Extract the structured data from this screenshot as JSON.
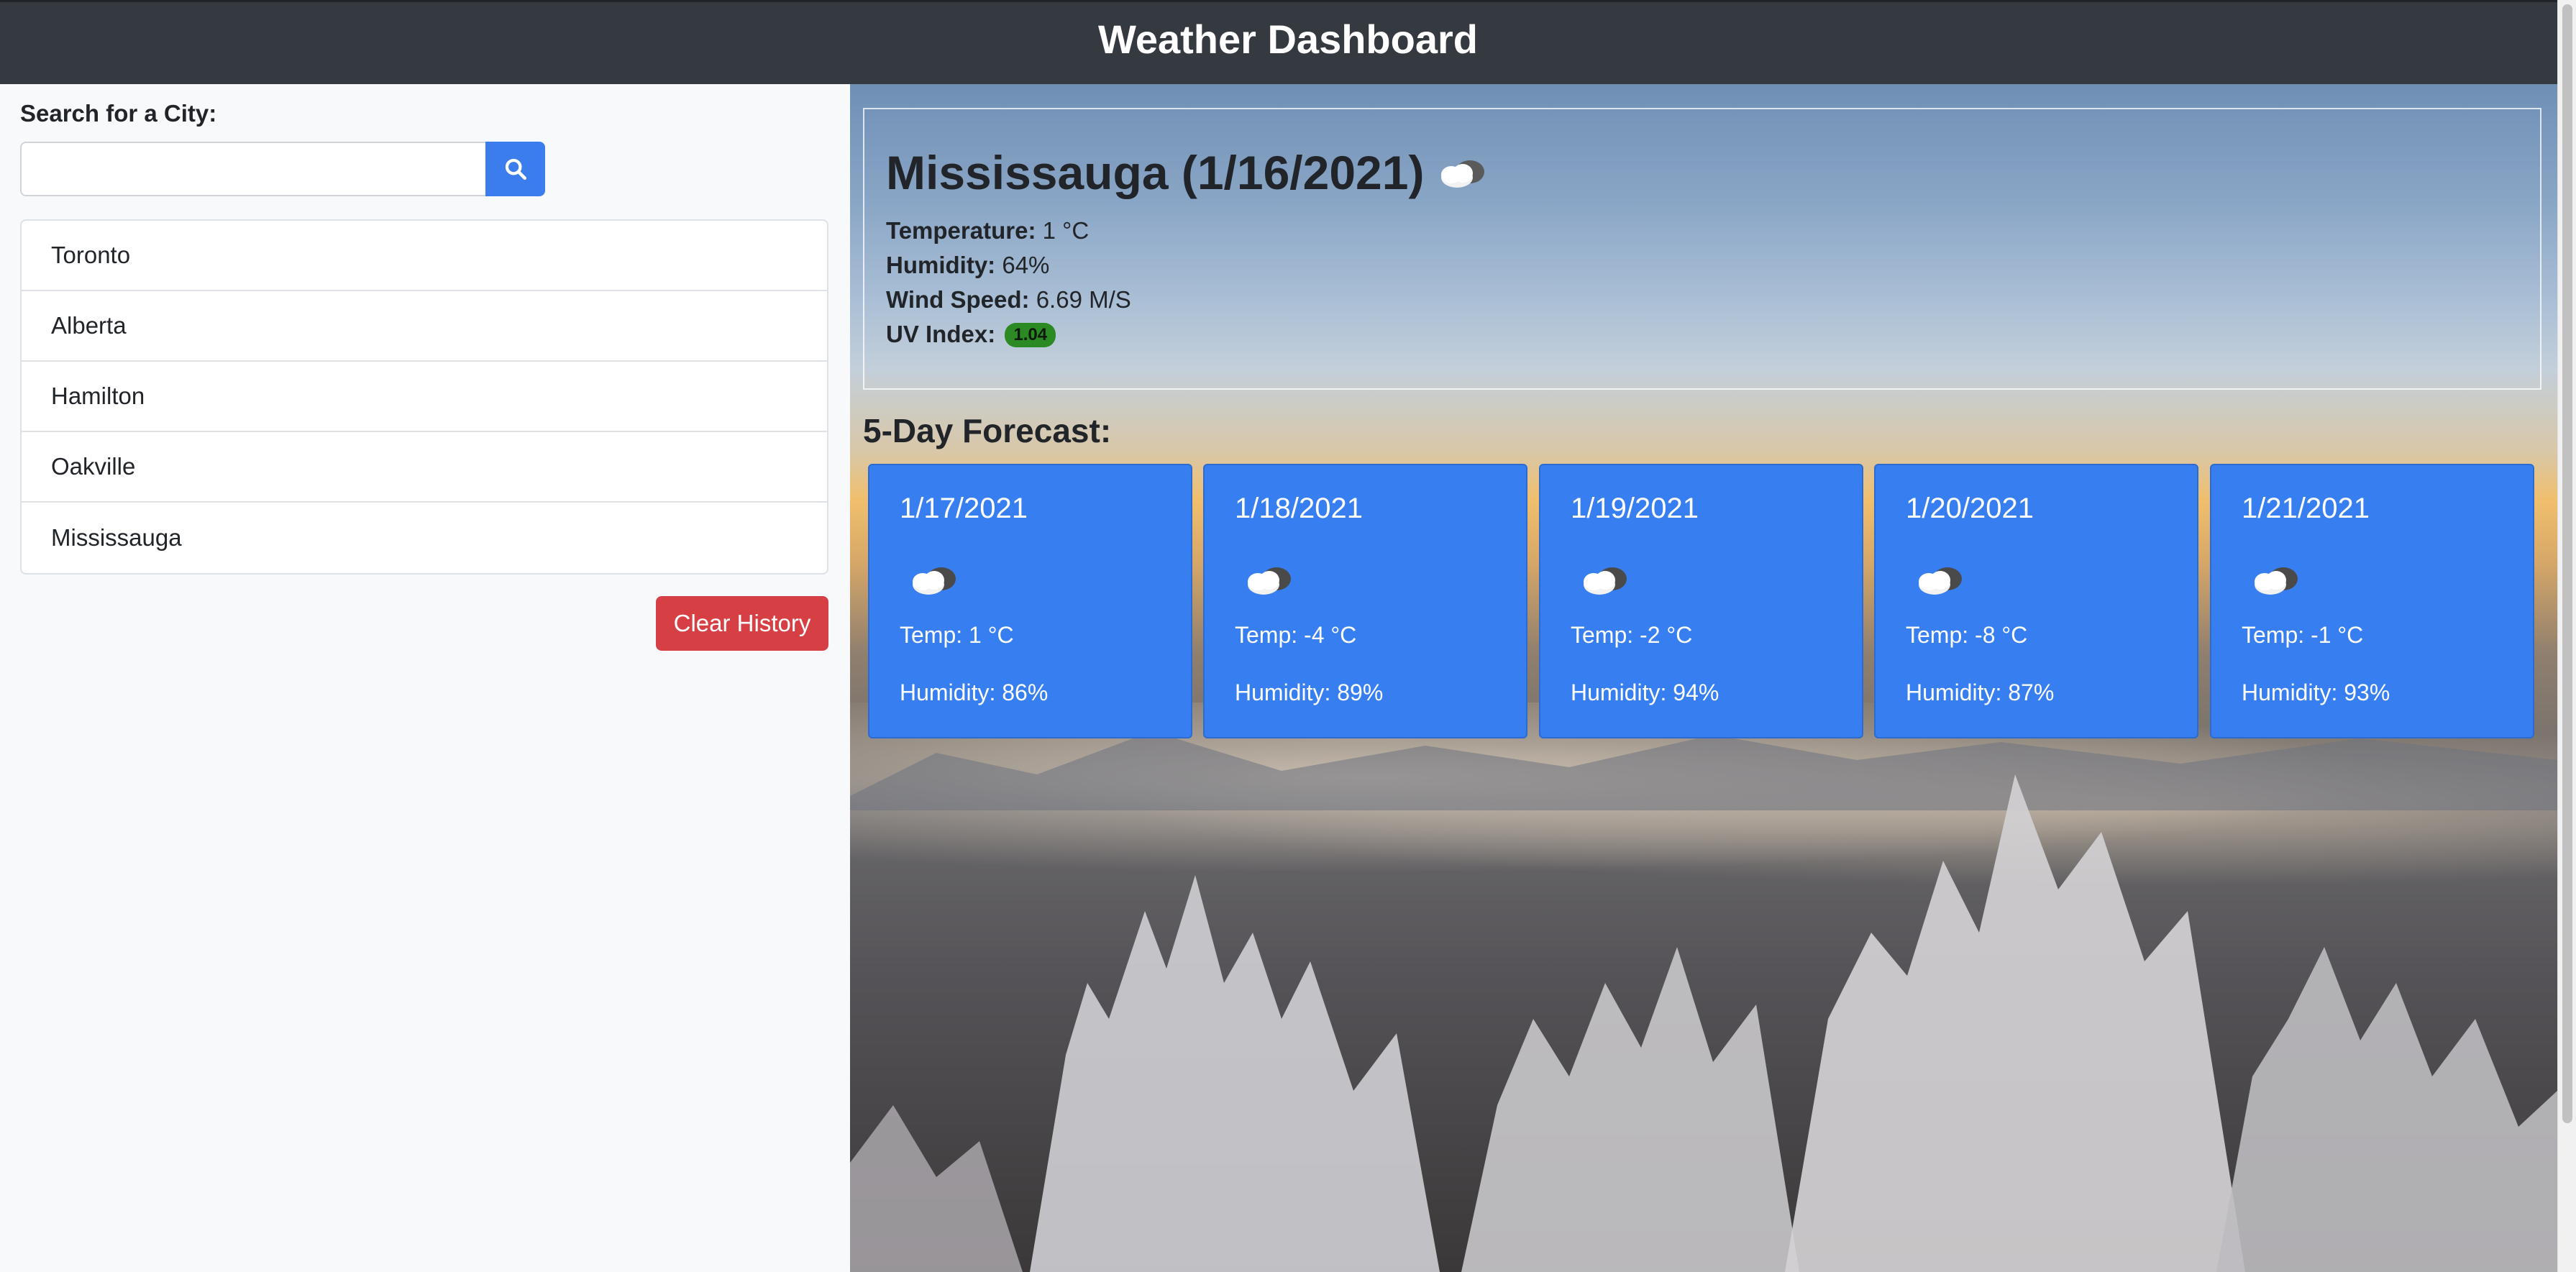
{
  "header": {
    "title": "Weather Dashboard"
  },
  "sidebar": {
    "search_label": "Search for a City:",
    "search_value": "",
    "search_icon": "search-icon",
    "history": [
      {
        "label": "Toronto"
      },
      {
        "label": "Alberta"
      },
      {
        "label": "Hamilton"
      },
      {
        "label": "Oakville"
      },
      {
        "label": "Mississauga"
      }
    ],
    "clear_label": "Clear History"
  },
  "current": {
    "city_title": "Mississauga (1/16/2021)",
    "icon": "cloud-icon",
    "temperature_label": "Temperature:",
    "temperature_value": "1 °C",
    "humidity_label": "Humidity:",
    "humidity_value": "64%",
    "wind_label": "Wind Speed:",
    "wind_value": "6.69 M/S",
    "uv_label": "UV Index:",
    "uv_value": "1.04"
  },
  "forecast": {
    "title": "5-Day Forecast:",
    "days": [
      {
        "date": "1/17/2021",
        "icon": "cloud-icon",
        "temp": "Temp: 1 °C",
        "humidity": "Humidity: 86%"
      },
      {
        "date": "1/18/2021",
        "icon": "cloud-icon",
        "temp": "Temp: -4 °C",
        "humidity": "Humidity: 89%"
      },
      {
        "date": "1/19/2021",
        "icon": "cloud-icon",
        "temp": "Temp: -2 °C",
        "humidity": "Humidity: 94%"
      },
      {
        "date": "1/20/2021",
        "icon": "cloud-icon",
        "temp": "Temp: -8 °C",
        "humidity": "Humidity: 87%"
      },
      {
        "date": "1/21/2021",
        "icon": "cloud-icon",
        "temp": "Temp: -1 °C",
        "humidity": "Humidity: 93%"
      }
    ]
  },
  "colors": {
    "header_bg": "#343a40",
    "search_button": "#3b7ded",
    "clear_button": "#d64045",
    "forecast_card": "#377ff0",
    "uv_badge": "#2b8a24"
  }
}
